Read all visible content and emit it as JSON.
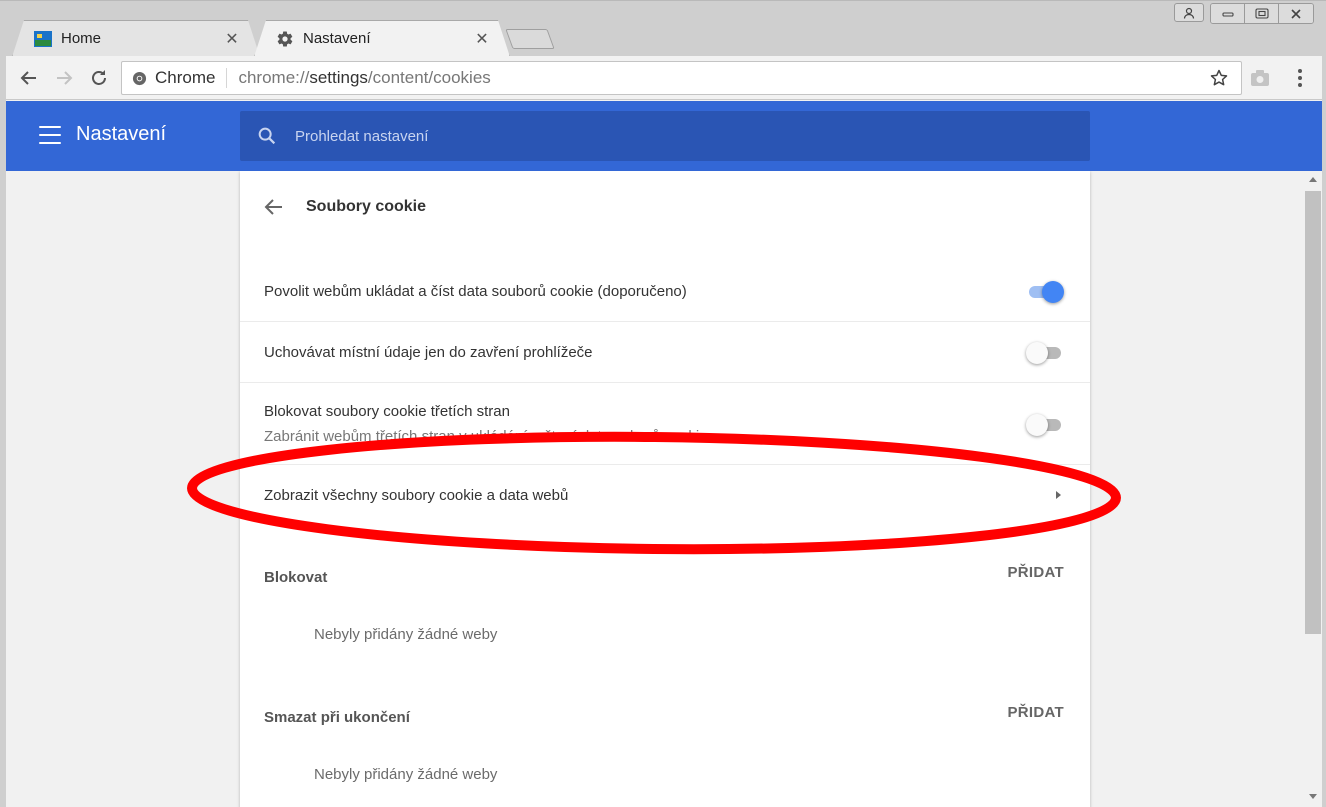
{
  "tabs": [
    {
      "title": "Home",
      "icon": "home-page-icon",
      "active": false
    },
    {
      "title": "Nastavení",
      "icon": "gear-icon",
      "active": true
    }
  ],
  "toolbar": {
    "site_label": "Chrome",
    "url_prefix": "chrome://",
    "url_host": "settings",
    "url_path": "/content/cookies"
  },
  "header": {
    "title": "Nastavení",
    "search_placeholder": "Prohledat nastavení"
  },
  "subpage": {
    "title": "Soubory cookie"
  },
  "rows": [
    {
      "label": "Povolit webům ukládat a číst data souborů cookie (doporučeno)",
      "toggle": true
    },
    {
      "label": "Uchovávat místní údaje jen do zavření prohlížeče",
      "toggle": false
    },
    {
      "label": "Blokovat soubory cookie třetích stran",
      "secondary": "Zabránit webům třetích stran v ukládání a čtení dat souborů cookie",
      "toggle": false
    },
    {
      "label": "Zobrazit všechny soubory cookie a data webů"
    }
  ],
  "sections": [
    {
      "label": "Blokovat",
      "add_label": "PŘIDAT",
      "empty_text": "Nebyly přidány žádné weby"
    },
    {
      "label": "Smazat při ukončení",
      "add_label": "PŘIDAT",
      "empty_text": "Nebyly přidány žádné weby"
    }
  ],
  "colors": {
    "header_blue": "#3367d6",
    "search_blue": "#2a55b4",
    "toggle_on": "#4285f4",
    "annotation_red": "#ff0000"
  }
}
